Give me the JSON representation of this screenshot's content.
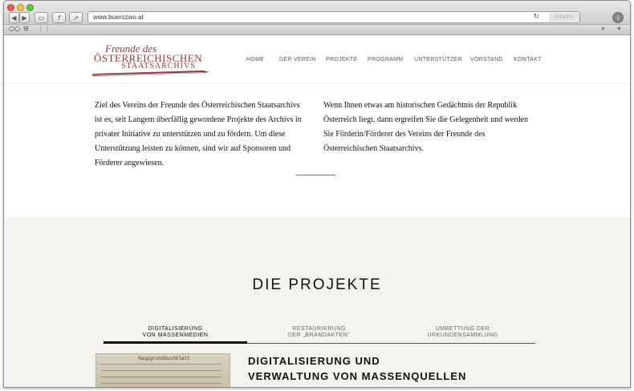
{
  "browser": {
    "url": "www.buerozwo.at",
    "reader_label": "Reader",
    "reload_icon": "reload-icon"
  },
  "site": {
    "logo": {
      "line1": "Freunde des",
      "line2": "ÖSTERREICHISCHEN",
      "line3": "STAATSARCHIVS"
    },
    "nav": [
      "HOME",
      "DER VEREIN",
      "PROJEKTE",
      "PROGRAMM",
      "UNTERSTÜTZER",
      "VORSTAND",
      "KONTAKT"
    ],
    "intro": {
      "left": "Ziel des Vereins der Freunde des Österreichischen Staatsarchivs ist es, seit Langem überfällig gewordene Projekte des Archivs in privater Initiative zu unterstützen und zu fördern. Um diese Unterstützung leisten zu können, sind wir auf Sponsoren und Förderer angewiesen.",
      "right": "Wenn Ihnen etwas am historischen Gedächtnis der Republik Österreich liegt, dann ergreifen Sie die Gelegenheit und werden Sie Förderin/Förderer des Vereins der Freunde des Österreichischen Staatsarchivs."
    },
    "projects": {
      "heading": "DIE PROJEKTE",
      "tabs": [
        {
          "line1": "DIGITALISIERUNG",
          "line2": "VON MASSENMEDIEN",
          "active": true
        },
        {
          "line1": "RESTAURIERUNG",
          "line2": "DER „BRANDAKTEN“",
          "active": false
        },
        {
          "line1": "UMBETTUNG DER",
          "line2": "URKUNDENSAMMLUNG",
          "active": false
        }
      ],
      "thumb_title": "Haupgrundbuchblatt",
      "active_title_line1": "DIGITALISIERUNG UND",
      "active_title_line2": "VERWALTUNG VON MASSENQUELLEN"
    }
  },
  "colors": {
    "brand": "#8a3d3d",
    "section_bg": "#f4f3ef"
  }
}
